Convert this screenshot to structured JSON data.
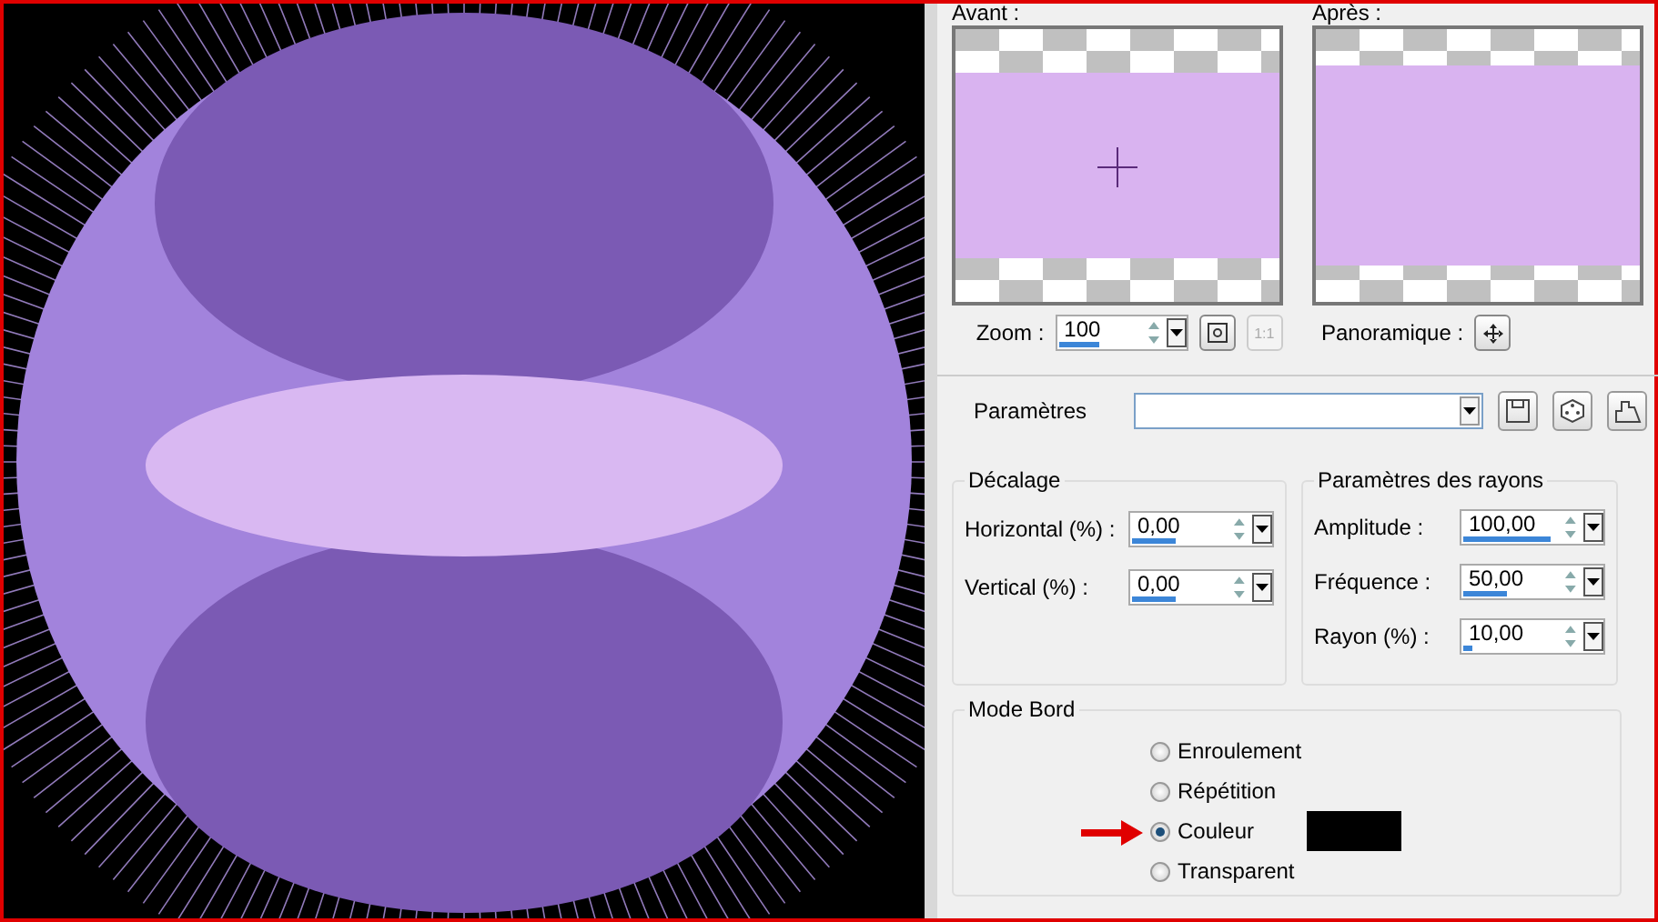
{
  "previews": [
    {
      "label": "Avant :",
      "kind": "before"
    },
    {
      "label": "Après :",
      "kind": "after"
    }
  ],
  "zoom": {
    "label": "Zoom :",
    "value": "100",
    "level": 0.55,
    "buttons": [
      {
        "kind": "fit",
        "disabled": false
      },
      {
        "kind": "actual",
        "label": "1:1",
        "disabled": true
      }
    ]
  },
  "pan": {
    "label": "Panoramique :"
  },
  "presets": {
    "label": "Paramètres"
  },
  "offset": {
    "title": "Décalage",
    "fields": [
      {
        "label": "Horizontal (%) :",
        "value": "0,00",
        "level": 0.5
      },
      {
        "label": "Vertical (%) :",
        "value": "0,00",
        "level": 0.5
      }
    ]
  },
  "rays": {
    "title": "Paramètres des rayons",
    "fields": [
      {
        "label": "Amplitude :",
        "value": "100,00",
        "level": 1
      },
      {
        "label": "Fréquence :",
        "value": "50,00",
        "level": 0.5
      },
      {
        "label": "Rayon (%) :",
        "value": "10,00",
        "level": 0.1
      }
    ]
  },
  "edge_mode": {
    "title": "Mode Bord",
    "options": [
      {
        "label": "Enroulement",
        "selected": false
      },
      {
        "label": "Répétition",
        "selected": false
      },
      {
        "label": "Couleur",
        "selected": true
      },
      {
        "label": "Transparent",
        "selected": false
      }
    ]
  }
}
